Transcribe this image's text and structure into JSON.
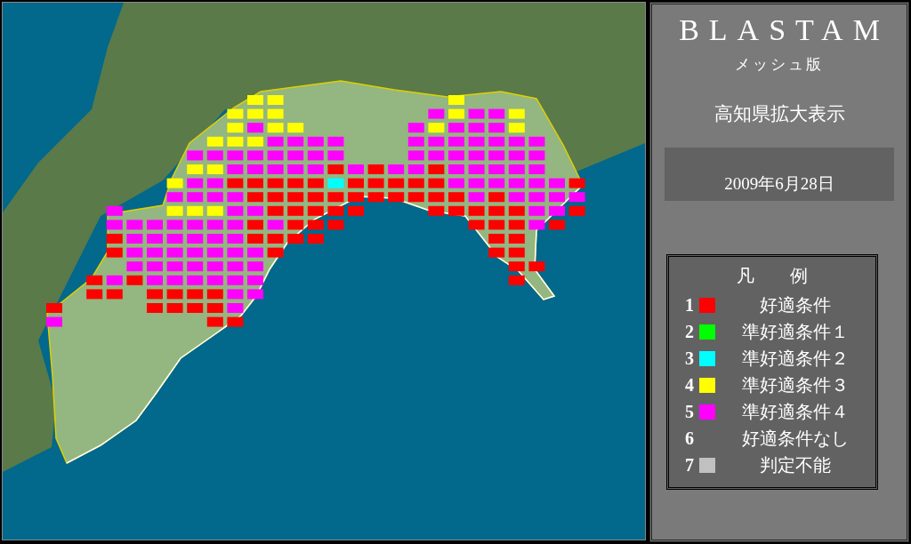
{
  "side_panel": {
    "title": "BLASTAM",
    "subtitle": "メッシュ版",
    "view_label": "高知県拡大表示",
    "date": "2009年6月28日"
  },
  "legend": {
    "heading": "凡　　例",
    "items": [
      {
        "number": "1",
        "color": "#ff0000",
        "label": "好適条件"
      },
      {
        "number": "2",
        "color": "#00ff00",
        "label": "準好適条件１"
      },
      {
        "number": "3",
        "color": "#00ffff",
        "label": "準好適条件２"
      },
      {
        "number": "4",
        "color": "#ffff00",
        "label": "準好適条件３"
      },
      {
        "number": "5",
        "color": "#ff00ff",
        "label": "準好適条件４"
      },
      {
        "number": "6",
        "label": "好適条件なし"
      },
      {
        "number": "7",
        "color": "#c0c0c0",
        "label": "判定不能"
      }
    ]
  }
}
